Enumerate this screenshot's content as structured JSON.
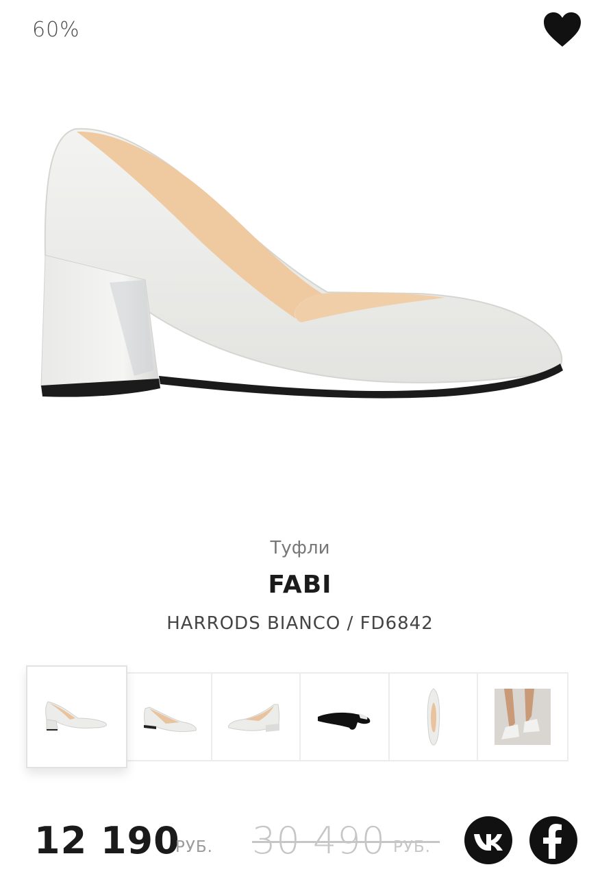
{
  "badge": {
    "discount": "60%"
  },
  "wishlist": {
    "icon": "heart-icon",
    "color": "#111111"
  },
  "product": {
    "category": "Туфли",
    "brand": "FABI",
    "model": "HARRODS BIANCO / FD6842",
    "color_hex": "#ededeb"
  },
  "gallery": {
    "thumbnails": [
      {
        "name": "side-view",
        "selected": true
      },
      {
        "name": "three-quarter-view"
      },
      {
        "name": "front-angle-view"
      },
      {
        "name": "sole-view"
      },
      {
        "name": "top-view"
      },
      {
        "name": "on-foot-view"
      }
    ]
  },
  "pricing": {
    "current": "12 190",
    "current_currency": "РУБ.",
    "old": "30 490",
    "old_currency": "РУБ."
  },
  "share": {
    "vk_icon": "vk-icon",
    "facebook_icon": "facebook-icon"
  }
}
